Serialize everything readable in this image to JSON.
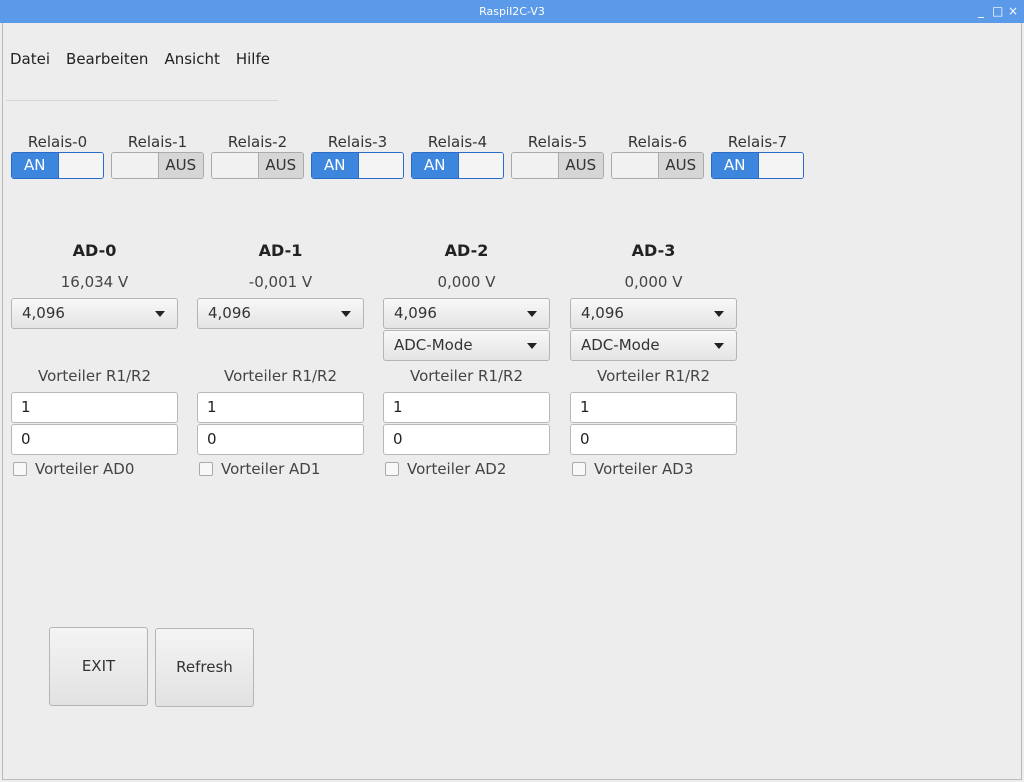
{
  "window": {
    "title": "RaspiI2C-V3",
    "controls": [
      "_",
      "□",
      "×"
    ]
  },
  "menu": [
    "Datei",
    "Bearbeiten",
    "Ansicht",
    "Hilfe"
  ],
  "relais": [
    {
      "label": "Relais-0",
      "state": "AN"
    },
    {
      "label": "Relais-1",
      "state": "AUS"
    },
    {
      "label": "Relais-2",
      "state": "AUS"
    },
    {
      "label": "Relais-3",
      "state": "AN"
    },
    {
      "label": "Relais-4",
      "state": "AN"
    },
    {
      "label": "Relais-5",
      "state": "AUS"
    },
    {
      "label": "Relais-6",
      "state": "AUS"
    },
    {
      "label": "Relais-7",
      "state": "AN"
    }
  ],
  "adc": [
    {
      "title": "AD-0",
      "value": "16,034 V",
      "range": "4,096",
      "mode": null,
      "divider_label": "Vorteiler R1/R2",
      "r1": "1",
      "r2": "0",
      "checkbox_label": "Vorteiler AD0",
      "checked": false
    },
    {
      "title": "AD-1",
      "value": "-0,001 V",
      "range": "4,096",
      "mode": null,
      "divider_label": "Vorteiler R1/R2",
      "r1": "1",
      "r2": "0",
      "checkbox_label": "Vorteiler AD1",
      "checked": false
    },
    {
      "title": "AD-2",
      "value": "0,000 V",
      "range": "4,096",
      "mode": "ADC-Mode",
      "divider_label": "Vorteiler R1/R2",
      "r1": "1",
      "r2": "0",
      "checkbox_label": "Vorteiler AD2",
      "checked": false
    },
    {
      "title": "AD-3",
      "value": "0,000 V",
      "range": "4,096",
      "mode": "ADC-Mode",
      "divider_label": "Vorteiler R1/R2",
      "r1": "1",
      "r2": "0",
      "checkbox_label": "Vorteiler AD3",
      "checked": false
    }
  ],
  "buttons": {
    "exit": "EXIT",
    "refresh": "Refresh"
  },
  "colors": {
    "titlebar": "#5b9ae8",
    "toggle_on": "#3d86de"
  }
}
